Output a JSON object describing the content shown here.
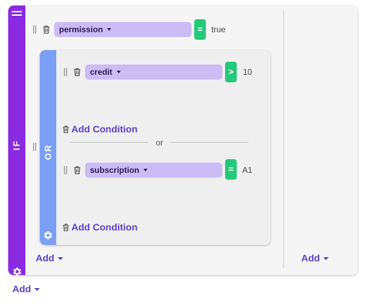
{
  "if_group": {
    "label": "IF",
    "rules": [
      {
        "field": "permission",
        "operator": "=",
        "value": "true"
      }
    ],
    "add_label": "Add"
  },
  "or_group": {
    "label": "OR",
    "separator": "or",
    "add_condition_label": "Add Condition",
    "rules": [
      {
        "field": "credit",
        "operator": ">",
        "value": "10"
      },
      {
        "field": "subscription",
        "operator": "=",
        "value": "A1"
      }
    ]
  },
  "then_column": {
    "add_label": "Add"
  },
  "root": {
    "add_label": "Add"
  },
  "colors": {
    "if_bar": "#8a2be2",
    "or_bar": "#7b9ff5",
    "field_pill": "#cbbcf6",
    "operator": "#25c97a",
    "link": "#5b3fc4"
  },
  "icons": [
    "menu-icon",
    "settings-gear-icon",
    "drag-handle-icon",
    "trash-icon",
    "chevron-down-icon"
  ]
}
